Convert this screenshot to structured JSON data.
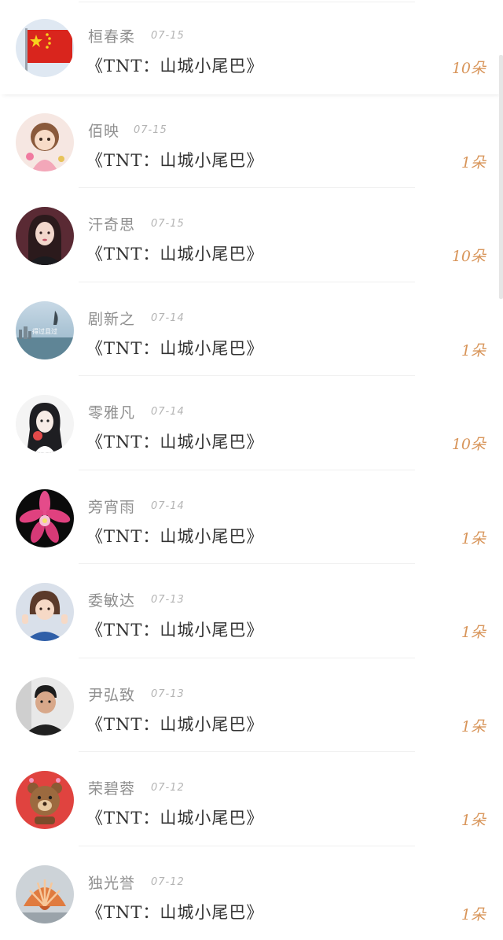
{
  "records": [
    {
      "name": "桓春柔",
      "date": "07-15",
      "gift": "《TNT：山城小尾巴》",
      "count": "10朵",
      "avatar": "china-flag"
    },
    {
      "name": "佰映",
      "date": "07-15",
      "gift": "《TNT：山城小尾巴》",
      "count": "1朵",
      "avatar": "cartoon-girl"
    },
    {
      "name": "汗奇思",
      "date": "07-15",
      "gift": "《TNT：山城小尾巴》",
      "count": "10朵",
      "avatar": "woman-portrait"
    },
    {
      "name": "剧新之",
      "date": "07-14",
      "gift": "《TNT：山城小尾巴》",
      "count": "1朵",
      "avatar": "seaside-scene",
      "avatar_text": "得过且过"
    },
    {
      "name": "零雅凡",
      "date": "07-14",
      "gift": "《TNT：山城小尾巴》",
      "count": "10朵",
      "avatar": "anime-girl"
    },
    {
      "name": "旁宵雨",
      "date": "07-14",
      "gift": "《TNT：山城小尾巴》",
      "count": "1朵",
      "avatar": "pink-flower"
    },
    {
      "name": "委敏达",
      "date": "07-13",
      "gift": "《TNT：山城小尾巴》",
      "count": "1朵",
      "avatar": "girl-selfie"
    },
    {
      "name": "尹弘致",
      "date": "07-13",
      "gift": "《TNT：山城小尾巴》",
      "count": "1朵",
      "avatar": "man-portrait"
    },
    {
      "name": "荣碧蓉",
      "date": "07-12",
      "gift": "《TNT：山城小尾巴》",
      "count": "1朵",
      "avatar": "cartoon-bear"
    },
    {
      "name": "独光誉",
      "date": "07-12",
      "gift": "《TNT：山城小尾巴》",
      "count": "1朵",
      "avatar": "seashell"
    }
  ],
  "colors": {
    "name": "#8f8f8f",
    "date": "#b4b4b4",
    "gift": "#333333",
    "count": "#d8955a",
    "divider": "#f0f0f0"
  }
}
